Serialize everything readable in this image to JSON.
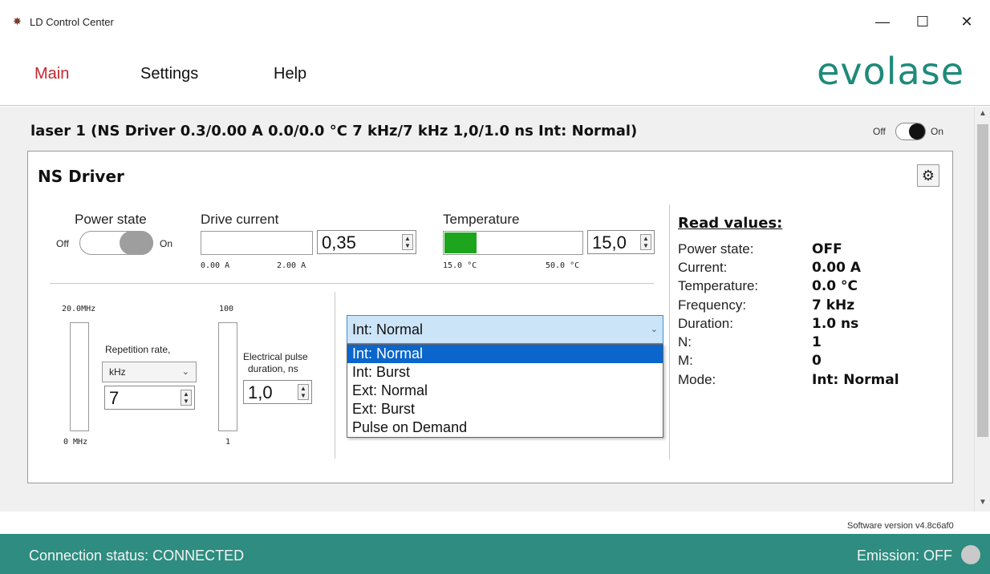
{
  "window": {
    "title": "LD Control Center",
    "icon": "app-laser-icon",
    "minimize_glyph": "—",
    "maximize_glyph": "☐",
    "close_glyph": "✕"
  },
  "menu": {
    "items": [
      {
        "label": "Main",
        "active": true
      },
      {
        "label": "Settings",
        "active": false
      },
      {
        "label": "Help",
        "active": false
      }
    ],
    "logo": "evolase"
  },
  "laser": {
    "header": "laser 1 (NS Driver 0.3/0.00 A  0.0/0.0 °C  7 kHz/7 kHz  1,0/1.0 ns  Int: Normal)",
    "toggle_off": "Off",
    "toggle_on": "On"
  },
  "driver": {
    "title": "NS Driver",
    "power_state": {
      "label": "Power state",
      "off": "Off",
      "on": "On"
    },
    "drive_current": {
      "label": "Drive current",
      "value": "0,35",
      "min": "0.00 A",
      "max": "2.00 A",
      "fill_fraction": 0.0
    },
    "temperature": {
      "label": "Temperature",
      "value": "15,0",
      "min": "15.0 °C",
      "max": "50.0 °C",
      "fill_fraction": 0.24,
      "fill_color": "#1ea51e"
    },
    "repetition": {
      "top_label": "20.0MHz",
      "bottom_label": "0 MHz",
      "label": "Repetition rate,",
      "unit": "kHz",
      "value": "7"
    },
    "pulse": {
      "top_label": "100",
      "bottom_label": "1",
      "label_line1": "Electrical pulse",
      "label_line2": "duration, ns",
      "value": "1,0"
    },
    "mode_select": {
      "value": "Int: Normal",
      "options": [
        "Int: Normal",
        "Int: Burst",
        "Ext: Normal",
        "Ext: Burst",
        "Pulse on Demand"
      ],
      "selected_index": 0
    }
  },
  "read_values": {
    "title": "Read values:",
    "rows": [
      {
        "label": "Power state:",
        "value": "OFF"
      },
      {
        "label": "Current:",
        "value": "0.00 A"
      },
      {
        "label": "Temperature:",
        "value": "0.0 °C"
      },
      {
        "label": "Frequency:",
        "value": "7 kHz"
      },
      {
        "label": "Duration:",
        "value": "1.0 ns"
      },
      {
        "label": "N:",
        "value": "1"
      },
      {
        "label": "M:",
        "value": "0"
      },
      {
        "label": "Mode:",
        "value": "Int: Normal"
      }
    ]
  },
  "footer": {
    "version": "Software version  v4.8c6af0",
    "connection": "Connection status: CONNECTED",
    "emission": "Emission: OFF",
    "accent": "#2e8c80"
  }
}
